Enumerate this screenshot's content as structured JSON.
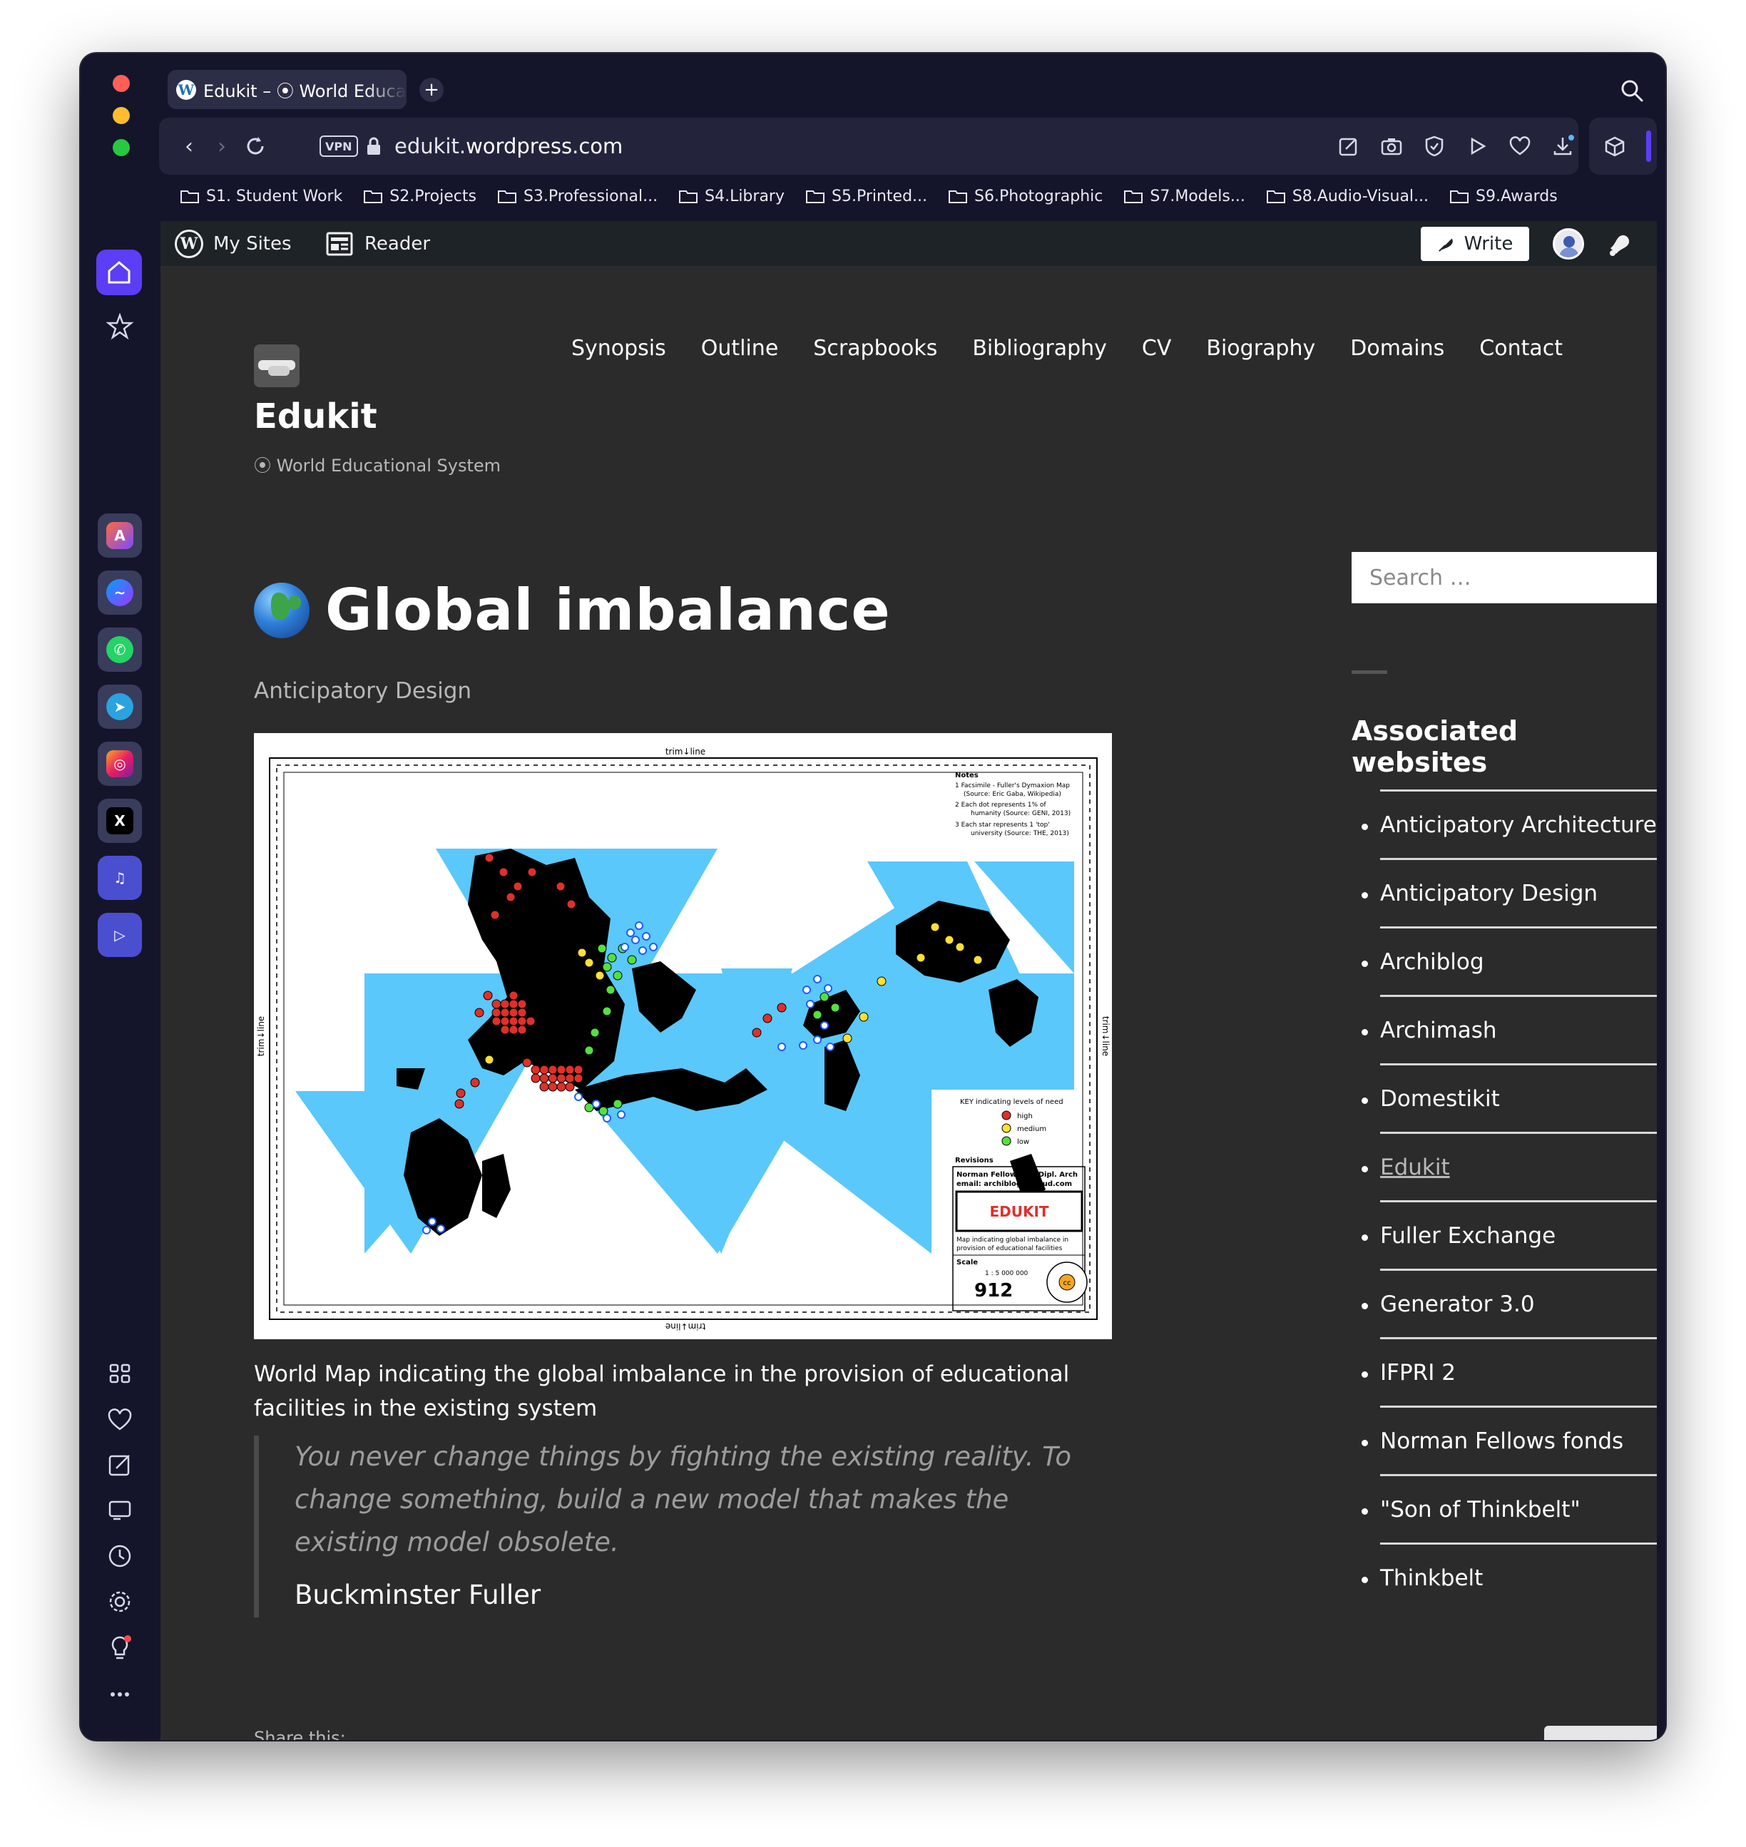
{
  "browser": {
    "tab_title": "Edukit – ⦿ World Educat",
    "tab_favicon": "W",
    "new_tab": "+",
    "vpn": "VPN",
    "url_host": "edukit.",
    "url_domain": "wordpress.com",
    "bookmarks": [
      "S1. Student Work",
      "S2.Projects",
      "S3.Professional...",
      "S4.Library",
      "S5.Printed...",
      "S6.Photographic",
      "S7.Models...",
      "S8.Audio-Visual...",
      "S9.Awards"
    ],
    "accent_color": "#5b3ef5"
  },
  "wp_admin": {
    "my_sites": "My Sites",
    "reader": "Reader",
    "write": "Write"
  },
  "site": {
    "title": "Edukit",
    "description": "⦿ World Educational System",
    "menu": [
      "Synopsis",
      "Outline",
      "Scrapbooks",
      "Bibliography",
      "CV",
      "Biography",
      "Domains",
      "Contact"
    ]
  },
  "post": {
    "title": "Global imbalance",
    "subtitle": "Anticipatory Design",
    "caption": "World Map indicating the global imbalance in the provision of educational facilities in the existing system",
    "quote": "You never change things by fighting the existing reality. To change something, build a new model that makes the existing model obsolete.",
    "quote_author": "Buckminster Fuller",
    "share_label": "Share this:"
  },
  "map": {
    "trim_top": "trim↓line",
    "trim_side": "trim↓line",
    "notes_title": "Notes",
    "note1": "1 Facsimile - Fuller's Dymaxion Map",
    "note1b": "(Source: Eric Gaba, Wikipedia)",
    "note2": "2 Each dot represents 1% of",
    "note2b": "humanity (Source: GENI, 2013)",
    "note3": "3 Each star represents 1 'top'",
    "note3b": "university (Source: THE, 2013)",
    "key_title": "KEY indicating levels of need",
    "key_high": "high",
    "key_medium": "medium",
    "key_low": "low",
    "revisions": "Revisions",
    "author": "Norman Fellows MA Dipl. Arch",
    "email": "email: archiblog@icloud.com",
    "stamp": "EDUKIT",
    "map_desc1": "Map indicating global imbalance in",
    "map_desc2": "provision of educational facilities",
    "scale_label": "Scale",
    "scale_value": "1 : 5 000 000",
    "sheet_number": "912",
    "cc": "cc"
  },
  "sidebar": {
    "search_placeholder": "Search …",
    "widget_title": "Associated websites",
    "sites": [
      "Anticipatory Architecture",
      "Anticipatory Design",
      "Archiblog",
      "Archimash",
      "Domestikit",
      "Edukit",
      "Fuller Exchange",
      "Generator 3.0",
      "IFPRI 2",
      "Norman Fellows fonds",
      "\"Son of Thinkbelt\"",
      "Thinkbelt"
    ],
    "current_site_index": 5
  }
}
